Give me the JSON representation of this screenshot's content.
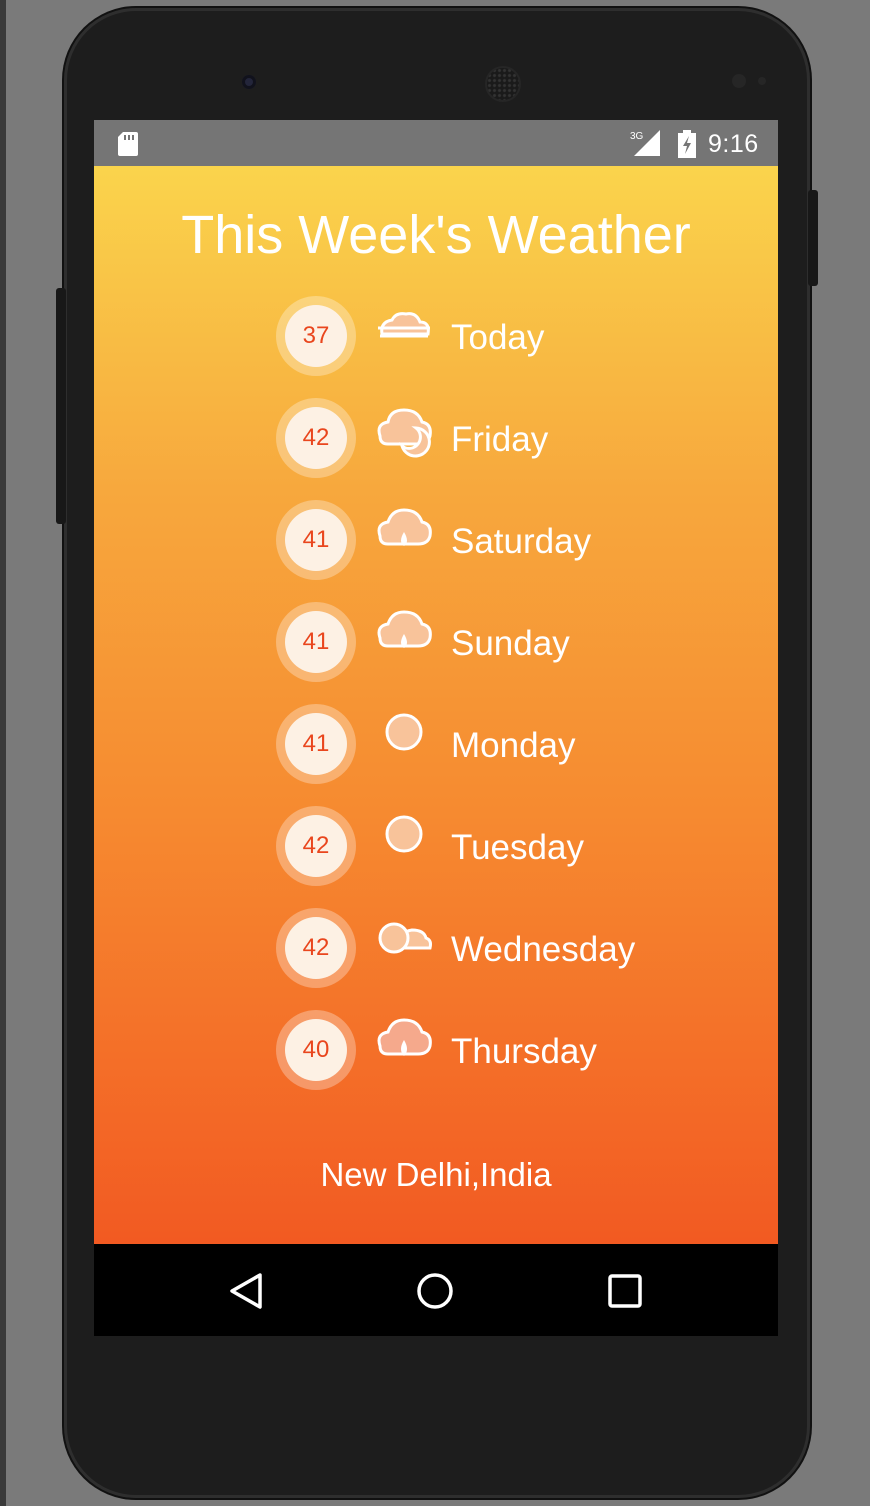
{
  "status_bar": {
    "time": "9:16",
    "network": "3G",
    "icons": [
      "sd-card-icon",
      "signal-3g-icon",
      "battery-charging-icon"
    ]
  },
  "app": {
    "title": "This Week's Weather",
    "location": "New Delhi,India",
    "forecast": [
      {
        "temp": "37",
        "day": "Today",
        "icon": "fog-icon"
      },
      {
        "temp": "42",
        "day": "Friday",
        "icon": "cloudy-night-icon"
      },
      {
        "temp": "41",
        "day": "Saturday",
        "icon": "rain-cloud-icon"
      },
      {
        "temp": "41",
        "day": "Sunday",
        "icon": "rain-cloud-icon"
      },
      {
        "temp": "41",
        "day": "Monday",
        "icon": "sun-icon"
      },
      {
        "temp": "42",
        "day": "Tuesday",
        "icon": "sun-icon"
      },
      {
        "temp": "42",
        "day": "Wednesday",
        "icon": "partly-cloudy-icon"
      },
      {
        "temp": "40",
        "day": "Thursday",
        "icon": "rain-cloud-icon"
      }
    ]
  },
  "nav_bar": {
    "icons": [
      "back-icon",
      "home-icon",
      "recent-apps-icon"
    ]
  },
  "colors": {
    "gradient_top": "#fad44c",
    "gradient_bottom": "#f25a22",
    "temp_text": "#e9461d",
    "icon_fill": "#f8c39a"
  }
}
